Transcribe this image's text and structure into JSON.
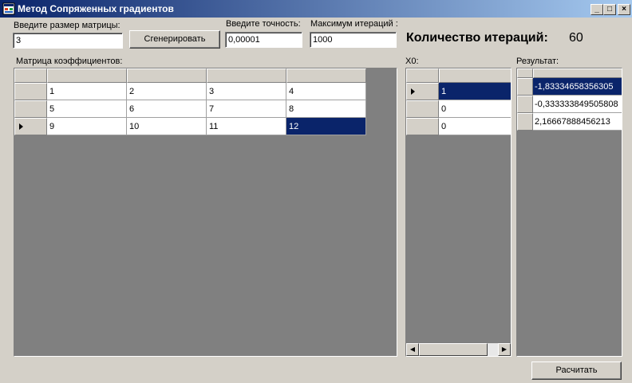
{
  "window": {
    "title": "Метод Сопряженных градиентов",
    "controls": {
      "minimize": "_",
      "maximize": "□",
      "close": "×"
    }
  },
  "form": {
    "size_label": "Введите размер матрицы:",
    "size_value": "3",
    "generate_button": "Сгенерировать",
    "precision_label": "Введите точность:",
    "precision_value": "0,00001",
    "max_iter_label": "Максимум итераций :",
    "max_iter_value": "1000",
    "iter_count_label": "Количество итераций:",
    "iter_count_value": "60",
    "calculate_button": "Расчитать"
  },
  "matrix": {
    "label": "Матрица коэффициентов:",
    "rows": [
      [
        "1",
        "2",
        "3",
        "4"
      ],
      [
        "5",
        "6",
        "7",
        "8"
      ],
      [
        "9",
        "10",
        "11",
        "12"
      ]
    ]
  },
  "x0": {
    "label": "X0:",
    "rows": [
      "1",
      "0",
      "0"
    ]
  },
  "result": {
    "label": "Результат:",
    "rows": [
      "-1,83334658356305",
      "-0,333333849505808",
      "2,16667888456213"
    ]
  }
}
